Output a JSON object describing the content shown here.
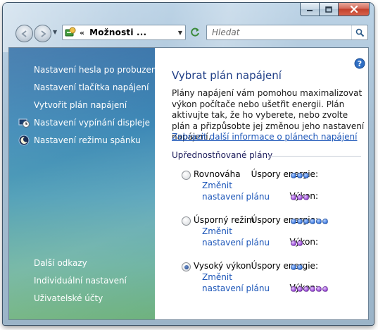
{
  "window": {
    "address_separator": "«",
    "address_text": "Možnosti ...",
    "search_placeholder": "Hledat"
  },
  "sidebar": {
    "tasks": [
      {
        "label": "Nastavení hesla po probuzení"
      },
      {
        "label": "Nastavení tlačítka napájení"
      },
      {
        "label": "Vytvořit plán napájení"
      },
      {
        "label": "Nastavení vypínání displeje",
        "icon": "display-timer-icon"
      },
      {
        "label": "Nastavení režimu spánku",
        "icon": "moon-icon"
      }
    ],
    "see_also": [
      {
        "label": "Další odkazy"
      },
      {
        "label": "Individuální nastavení"
      },
      {
        "label": "Uživatelské účty"
      }
    ]
  },
  "main": {
    "title": "Vybrat plán napájení",
    "description": "Plány napájení vám pomohou maximalizovat výkon počítače nebo ušetřit energii. Plán aktivujte tak, že ho vyberete, nebo zvolte plán a přizpůsobte jej změnou jeho nastavení napájení.",
    "more_info_link": "Zobrazit další informace o plánech napájení",
    "section_header": "Upřednostňované plány",
    "savings_label": "Úspory energie:",
    "performance_label": "Výkon:",
    "change_link": "Změnit nastavení plánu",
    "plans": [
      {
        "name": "Rovnováha",
        "selected": false,
        "savings_level": 3,
        "performance_level": 3
      },
      {
        "name": "Úsporný režim",
        "selected": false,
        "savings_level": 6,
        "performance_level": 2
      },
      {
        "name": "Vysoký výkon",
        "selected": true,
        "savings_level": 2,
        "performance_level": 6
      }
    ]
  },
  "colors": {
    "sidebar_top": "#2c6ba4",
    "sidebar_bottom": "#6fb27e",
    "title": "#1f3e86",
    "link": "#1b55b8",
    "savings_dot": "#3a78e0",
    "performance_dot": "#9a4ad8"
  }
}
